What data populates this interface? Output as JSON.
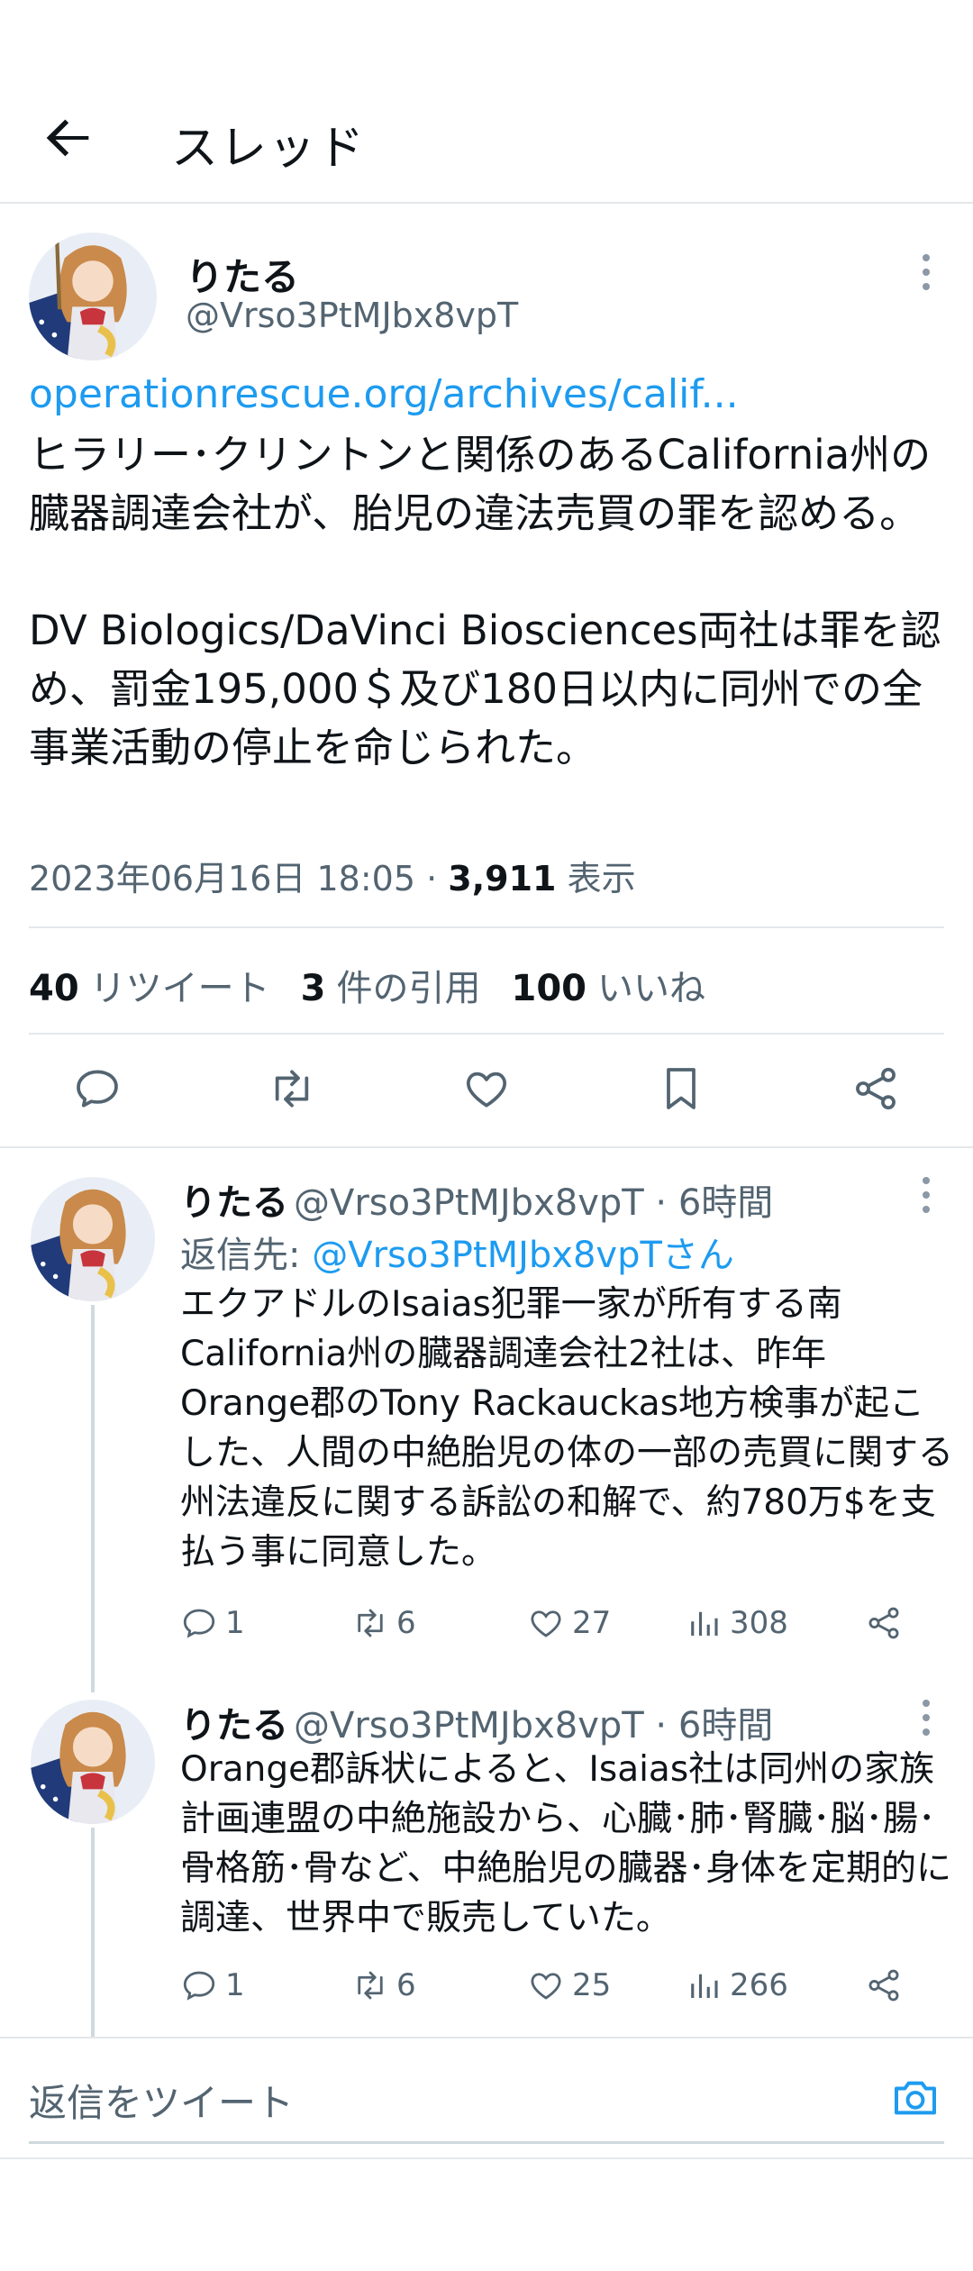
{
  "header": {
    "title": "スレッド"
  },
  "main_tweet": {
    "name": "りたる",
    "handle": "@Vrso3PtMJbx8vpT",
    "link": "operationrescue.org/archives/calif...",
    "text": "ヒラリー･クリントンと関係のあるCalifornia州の臓器調達会社が、胎児の違法売買の罪を認める。\n\nDV Biologics/DaVinci Biosciences両社は罪を認め、罰金195,000＄及び180日以内に同州での全事業活動の停止を命じられた。",
    "timestamp": "2023年06月16日 18:05",
    "views_count": "3,911",
    "views_label": "表示",
    "stats": {
      "retweets_count": "40",
      "retweets_label": "リツイート",
      "quotes_count": "3",
      "quotes_label": "件の引用",
      "likes_count": "100",
      "likes_label": "いいね"
    }
  },
  "replies": [
    {
      "name": "りたる",
      "handle": "@Vrso3PtMJbx8vpT",
      "time": "6時間",
      "reply_to_label": "返信先: ",
      "reply_to_handle": "@Vrso3PtMJbx8vpTさん",
      "text": "エクアドルのIsaias犯罪一家が所有する南California州の臓器調達会社2社は、昨年Orange郡のTony Rackauckas地方検事が起こした、人間の中絶胎児の体の一部の売買に関する州法違反に関する訴訟の和解で、約780万$を支払う事に同意した。",
      "replies": "1",
      "retweets": "6",
      "likes": "27",
      "views": "308"
    },
    {
      "name": "りたる",
      "handle": "@Vrso3PtMJbx8vpT",
      "time": "6時間",
      "text": "Orange郡訴状によると、Isaias社は同州の家族計画連盟の中絶施設から、心臓･肺･腎臓･脳･腸･骨格筋･骨など、中絶胎児の臓器･身体を定期的に調達、世界中で販売していた。",
      "replies": "1",
      "retweets": "6",
      "likes": "25",
      "views": "266"
    }
  ],
  "composer": {
    "placeholder": "返信をツイート"
  },
  "colors": {
    "accent": "#1d9bf0",
    "text": "#0f1419",
    "secondary": "#536471",
    "divider": "#e4e7ea"
  }
}
